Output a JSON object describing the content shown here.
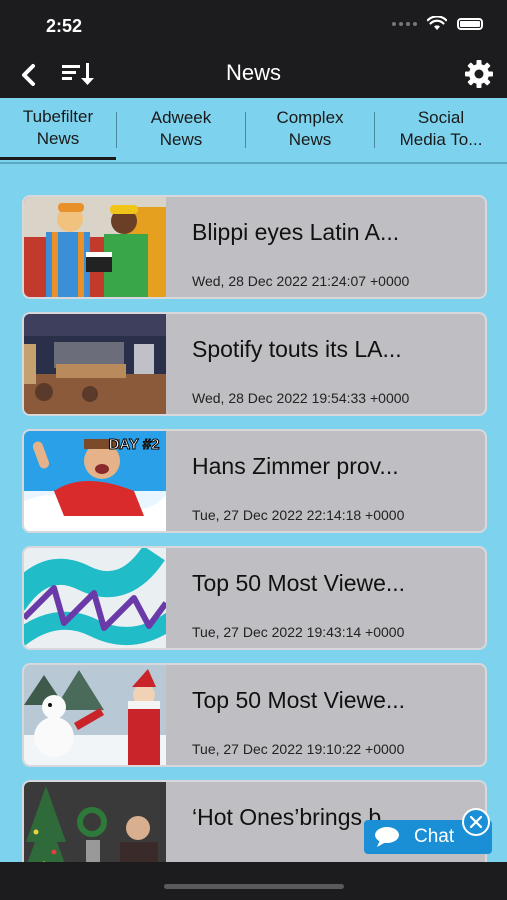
{
  "status_bar": {
    "time": "2:52"
  },
  "nav": {
    "title": "News"
  },
  "tabs": [
    {
      "label_line1": "Tubefilter",
      "label_line2": "News",
      "active": true
    },
    {
      "label_line1": "Adweek",
      "label_line2": "News",
      "active": false
    },
    {
      "label_line1": "Complex",
      "label_line2": "News",
      "active": false
    },
    {
      "label_line1": "Social",
      "label_line2": "Media To...",
      "active": false
    }
  ],
  "articles": [
    {
      "title": "Blippi eyes Latin A...",
      "date": "Wed, 28 Dec 2022 21:24:07 +0000",
      "thumb_text": ""
    },
    {
      "title": "Spotify touts its LA...",
      "date": "Wed, 28 Dec 2022 19:54:33 +0000",
      "thumb_text": ""
    },
    {
      "title": "Hans Zimmer prov...",
      "date": "Tue, 27 Dec 2022 22:14:18 +0000",
      "thumb_text": "DAY #2"
    },
    {
      "title": "Top 50 Most Viewe...",
      "date": "Tue, 27 Dec 2022 19:43:14 +0000",
      "thumb_text": ""
    },
    {
      "title": "Top 50 Most Viewe...",
      "date": "Tue, 27 Dec 2022 19:10:22 +0000",
      "thumb_text": ""
    },
    {
      "title": "‘Hot Ones’brings b...",
      "date": "",
      "thumb_text": ""
    }
  ],
  "chat": {
    "label": "Chat"
  },
  "colors": {
    "background": "#7dd3ee",
    "nav_bar": "#1c1c1e",
    "card": "#bfbfc3",
    "chat_button": "#1a8fd6"
  }
}
